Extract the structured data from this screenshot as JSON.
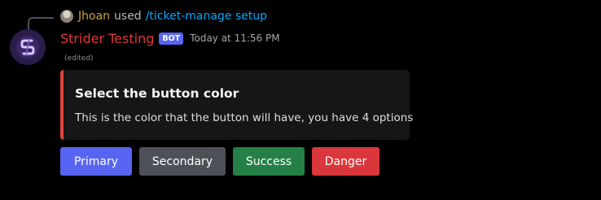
{
  "reply": {
    "user": "Jhoan",
    "used": "used",
    "command": "/ticket-manage setup"
  },
  "message": {
    "username": "Strider Testing",
    "bot_tag": "BOT",
    "timestamp": "Today at 11:56 PM",
    "edited": "(edited)",
    "username_color": "#e03a3a"
  },
  "embed": {
    "title": "Select the button color",
    "description": "This is the color that the button will have, you have 4 options",
    "color": "#e0443b"
  },
  "buttons": [
    {
      "label": "Primary",
      "color": "#5865f2"
    },
    {
      "label": "Secondary",
      "color": "#4e5058"
    },
    {
      "label": "Success",
      "color": "#248046"
    },
    {
      "label": "Danger",
      "color": "#da373c"
    }
  ]
}
